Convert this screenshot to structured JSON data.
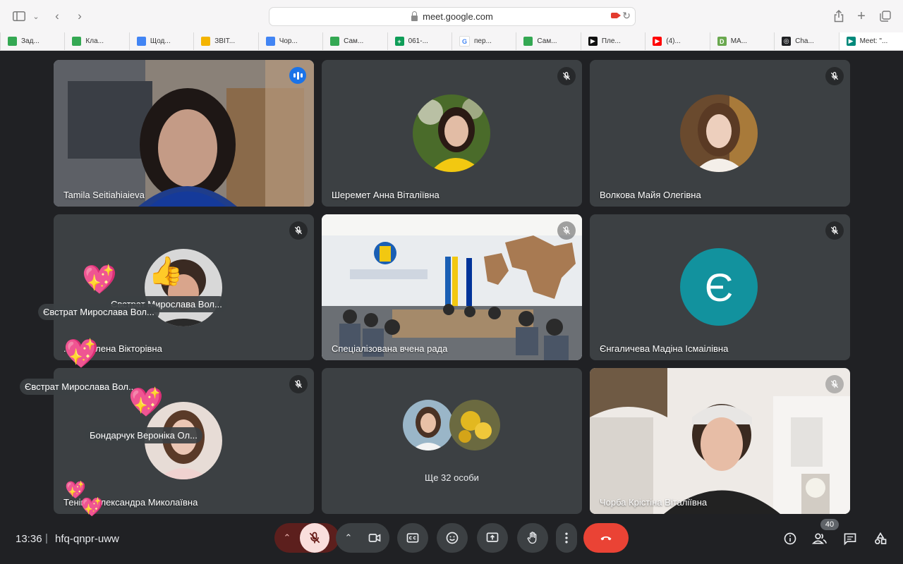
{
  "browser": {
    "url": "meet.google.com",
    "tabs": [
      {
        "label": "Зад...",
        "fav_color": "#34a853",
        "fav_glyph": ""
      },
      {
        "label": "Кла...",
        "fav_color": "#34a853",
        "fav_glyph": ""
      },
      {
        "label": "Щод...",
        "fav_color": "#4285f4",
        "fav_glyph": ""
      },
      {
        "label": "ЗВІТ...",
        "fav_color": "#f4b400",
        "fav_glyph": ""
      },
      {
        "label": "Чор...",
        "fav_color": "#4285f4",
        "fav_glyph": ""
      },
      {
        "label": "Сам...",
        "fav_color": "#34a853",
        "fav_glyph": ""
      },
      {
        "label": "061-...",
        "fav_color": "#0f9d58",
        "fav_glyph": "+"
      },
      {
        "label": "пер...",
        "fav_color": "#ffffff",
        "fav_glyph": "G"
      },
      {
        "label": "Сам...",
        "fav_color": "#34a853",
        "fav_glyph": ""
      },
      {
        "label": "Пле...",
        "fav_color": "#111111",
        "fav_glyph": "▶"
      },
      {
        "label": "(4)...",
        "fav_color": "#ff0000",
        "fav_glyph": "▶"
      },
      {
        "label": "МА...",
        "fav_color": "#6aa84f",
        "fav_glyph": "D"
      },
      {
        "label": "Cha...",
        "fav_color": "#202124",
        "fav_glyph": "◎"
      },
      {
        "label": "Meet: \"...",
        "fav_color": "#00897b",
        "fav_glyph": "▶"
      }
    ]
  },
  "tiles": [
    {
      "name": "Tamila Seitiahiaieva",
      "type": "video",
      "speaking": true
    },
    {
      "name": "Шеремет Анна Віталіївна",
      "type": "avatar",
      "muted": true
    },
    {
      "name": "Волкова Майя Олегівна",
      "type": "avatar",
      "muted": true
    },
    {
      "name": "...сць Олена Вікторівна",
      "type": "avatar",
      "muted": true
    },
    {
      "name": "Спеціалізована вчена рада",
      "type": "video",
      "muted": true
    },
    {
      "name": "Єнгаличева Мадіна Ісмаілівна",
      "type": "letter",
      "letter": "Є",
      "muted": true
    },
    {
      "name": "Теніна Олександра Миколаївна",
      "type": "avatar",
      "muted": true
    },
    {
      "name": "Ще 32 особи",
      "type": "others"
    },
    {
      "name": "Чорба Крістіна Віталіївна",
      "type": "video",
      "muted": true
    }
  ],
  "reactions": [
    {
      "label": "Євстрат Мирослава Вол...",
      "emoji": "💖"
    },
    {
      "label": "Євстрат Мирослава Вол...",
      "emoji": "👍"
    },
    {
      "label": "Євстрат Мирослава Вол...",
      "emoji": "💖"
    },
    {
      "label": "Бондарчук Вероніка Ол...",
      "emoji": "💖"
    }
  ],
  "bottom_bar": {
    "time": "13:36",
    "separator": "|",
    "meeting_code": "hfq-qnpr-uww",
    "participants_count": "40"
  },
  "colors": {
    "background": "#202124",
    "tile": "#3c4043",
    "speaking_border": "#8ab4f8",
    "end_call": "#ea4335",
    "mic_off_bg": "#f9dedc",
    "letter_avatar": "#12929e"
  }
}
